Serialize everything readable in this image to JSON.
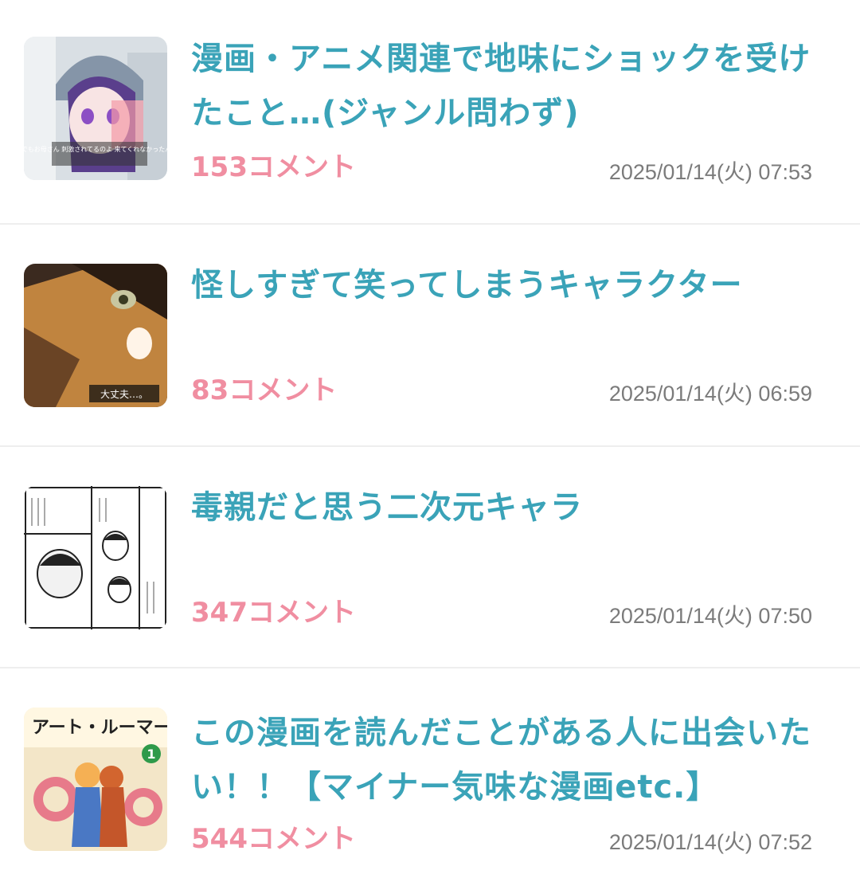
{
  "articles": [
    {
      "title": "漫画・アニメ関連で地味にショックを受けたこと…(ジャンル問わず)",
      "comments": "153コメント",
      "date": "2025/01/14(火) 07:53",
      "thumb_caption": "でもお母さん 刺激されてるのよ 来てくれなかったんだ"
    },
    {
      "title": "怪しすぎて笑ってしまうキャラクター",
      "comments": "83コメント",
      "date": "2025/01/14(火) 06:59",
      "thumb_caption": "大丈夫…。"
    },
    {
      "title": "毒親だと思う二次元キャラ",
      "comments": "347コメント",
      "date": "2025/01/14(火) 07:50"
    },
    {
      "title": "この漫画を読んだことがある人に出会いたい！！【マイナー気味な漫画etc.】",
      "comments": "544コメント",
      "date": "2025/01/14(火) 07:52",
      "thumb_logo": "アート・ルーマー",
      "thumb_volume": "1"
    }
  ],
  "colors": {
    "title": "#3aa3b8",
    "comments": "#f08ea1",
    "date": "#7b7b7b",
    "divider": "#eeeeee"
  }
}
